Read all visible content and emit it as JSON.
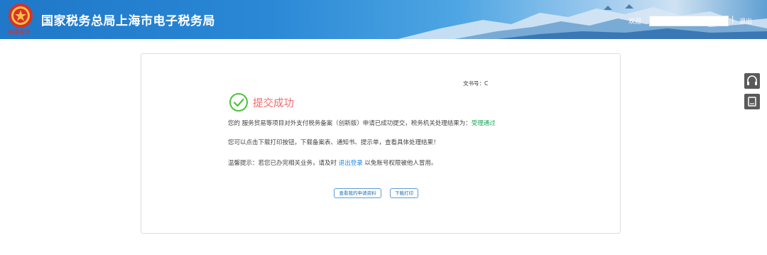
{
  "header": {
    "title": "国家税务总局上海市电子税务局",
    "emblem_caption": "中国税务",
    "welcome_label": "欢迎",
    "user_name": "",
    "separator": "|",
    "logout_label": "退出"
  },
  "result": {
    "doc_number_label": "文书号：C",
    "status_title": "提交成功",
    "message_prefix": "您的 服务贸易等项目对外支付税务备案（创新版）申请已成功提交，税务机关处理结果为：",
    "message_status": "受理通过",
    "download_hint": "您可以点击下载打印按钮，下载备案表、通知书、提示单，查看具体处理结果！",
    "tip_prefix": "温馨提示：若您已办完相关业务，请及时 ",
    "tip_link": "退出登录",
    "tip_suffix": " 以免账号权限被他人冒用。"
  },
  "actions": {
    "view_application_label": "查看我的申请资料",
    "download_print_label": "下载打印"
  },
  "side_tools": [
    {
      "icon": "headset-icon"
    },
    {
      "icon": "book-icon"
    }
  ],
  "colors": {
    "header_blue": "#2a88d6",
    "success_green": "#4cc23a",
    "title_red": "#f26b6b",
    "status_green": "#1aa35a",
    "link_blue": "#1e88e5"
  }
}
